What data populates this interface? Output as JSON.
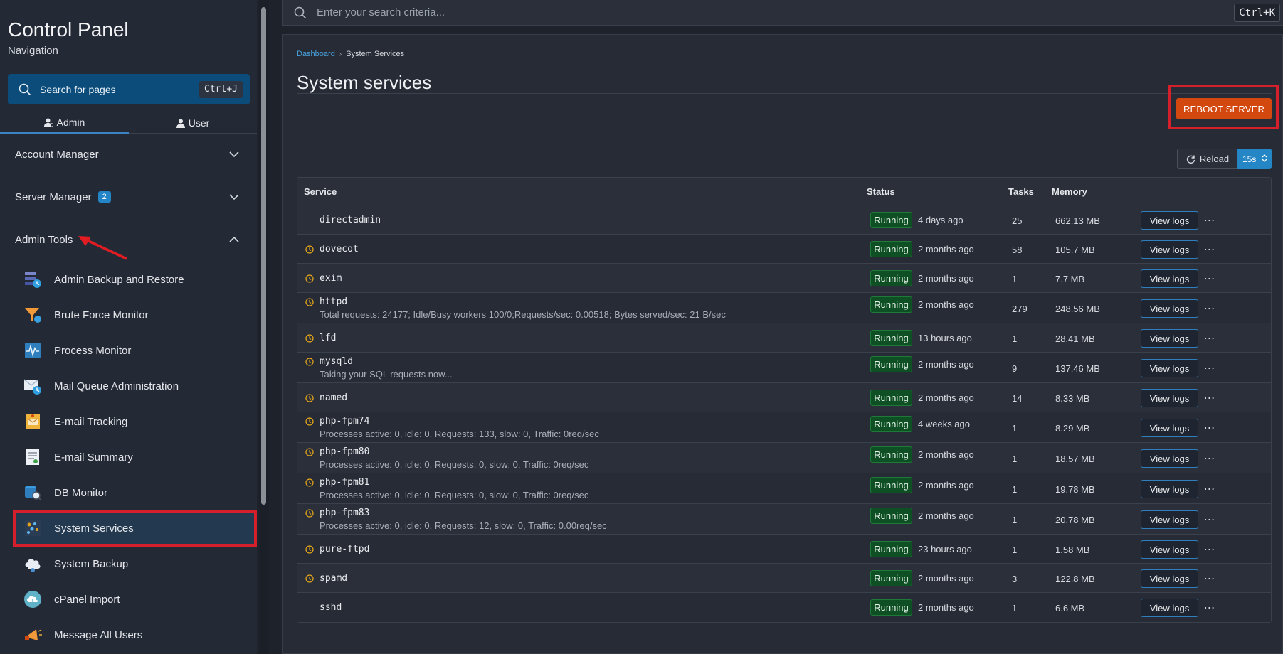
{
  "sidebar": {
    "title": "Control Panel",
    "subtitle": "Navigation",
    "search_label": "Search for pages",
    "search_shortcut": "Ctrl+J",
    "tabs": [
      {
        "label": "Admin"
      },
      {
        "label": "User"
      }
    ],
    "sections": [
      {
        "label": "Account Manager"
      },
      {
        "label": "Server Manager",
        "badge": "2"
      },
      {
        "label": "Admin Tools"
      }
    ],
    "items": [
      {
        "label": "Admin Backup and Restore"
      },
      {
        "label": "Brute Force Monitor"
      },
      {
        "label": "Process Monitor"
      },
      {
        "label": "Mail Queue Administration"
      },
      {
        "label": "E-mail Tracking"
      },
      {
        "label": "E-mail Summary"
      },
      {
        "label": "DB Monitor"
      },
      {
        "label": "System Services"
      },
      {
        "label": "System Backup"
      },
      {
        "label": "cPanel Import"
      },
      {
        "label": "Message All Users"
      }
    ]
  },
  "topsearch": {
    "placeholder": "Enter your search criteria...",
    "shortcut": "Ctrl+K"
  },
  "breadcrumb": {
    "parent": "Dashboard",
    "current": "System Services"
  },
  "page": {
    "title": "System services",
    "reboot_label": "REBOOT SERVER",
    "reload_label": "Reload",
    "interval": "15s"
  },
  "table": {
    "columns": {
      "service": "Service",
      "status": "Status",
      "tasks": "Tasks",
      "memory": "Memory"
    },
    "action_label": "View logs",
    "rows": [
      {
        "name": "directadmin",
        "desc": "",
        "status": "Running",
        "since": "4 days ago",
        "tasks": "25",
        "memory": "662.13 MB",
        "clock": false
      },
      {
        "name": "dovecot",
        "desc": "",
        "status": "Running",
        "since": "2 months ago",
        "tasks": "58",
        "memory": "105.7 MB",
        "clock": true
      },
      {
        "name": "exim",
        "desc": "",
        "status": "Running",
        "since": "2 months ago",
        "tasks": "1",
        "memory": "7.7 MB",
        "clock": true
      },
      {
        "name": "httpd",
        "desc": "Total requests: 24177; Idle/Busy workers 100/0;Requests/sec: 0.00518; Bytes served/sec: 21 B/sec",
        "status": "Running",
        "since": "2 months ago",
        "tasks": "279",
        "memory": "248.56 MB",
        "clock": true
      },
      {
        "name": "lfd",
        "desc": "",
        "status": "Running",
        "since": "13 hours ago",
        "tasks": "1",
        "memory": "28.41 MB",
        "clock": true
      },
      {
        "name": "mysqld",
        "desc": "Taking your SQL requests now...",
        "status": "Running",
        "since": "2 months ago",
        "tasks": "9",
        "memory": "137.46 MB",
        "clock": true
      },
      {
        "name": "named",
        "desc": "",
        "status": "Running",
        "since": "2 months ago",
        "tasks": "14",
        "memory": "8.33 MB",
        "clock": true
      },
      {
        "name": "php-fpm74",
        "desc": "Processes active: 0, idle: 0, Requests: 133, slow: 0, Traffic: 0req/sec",
        "status": "Running",
        "since": "4 weeks ago",
        "tasks": "1",
        "memory": "8.29 MB",
        "clock": true
      },
      {
        "name": "php-fpm80",
        "desc": "Processes active: 0, idle: 0, Requests: 0, slow: 0, Traffic: 0req/sec",
        "status": "Running",
        "since": "2 months ago",
        "tasks": "1",
        "memory": "18.57 MB",
        "clock": true
      },
      {
        "name": "php-fpm81",
        "desc": "Processes active: 0, idle: 0, Requests: 0, slow: 0, Traffic: 0req/sec",
        "status": "Running",
        "since": "2 months ago",
        "tasks": "1",
        "memory": "19.78 MB",
        "clock": true
      },
      {
        "name": "php-fpm83",
        "desc": "Processes active: 0, idle: 0, Requests: 12, slow: 0, Traffic: 0.00req/sec",
        "status": "Running",
        "since": "2 months ago",
        "tasks": "1",
        "memory": "20.78 MB",
        "clock": true
      },
      {
        "name": "pure-ftpd",
        "desc": "",
        "status": "Running",
        "since": "23 hours ago",
        "tasks": "1",
        "memory": "1.58 MB",
        "clock": true
      },
      {
        "name": "spamd",
        "desc": "",
        "status": "Running",
        "since": "2 months ago",
        "tasks": "3",
        "memory": "122.8 MB",
        "clock": true
      },
      {
        "name": "sshd",
        "desc": "",
        "status": "Running",
        "since": "2 months ago",
        "tasks": "1",
        "memory": "6.6 MB",
        "clock": false
      }
    ]
  },
  "colors": {
    "accent": "#2586c6",
    "danger": "#d2480f",
    "highlight": "#d51f2a",
    "running": "#0f4f24",
    "clock": "#e0a31b"
  }
}
